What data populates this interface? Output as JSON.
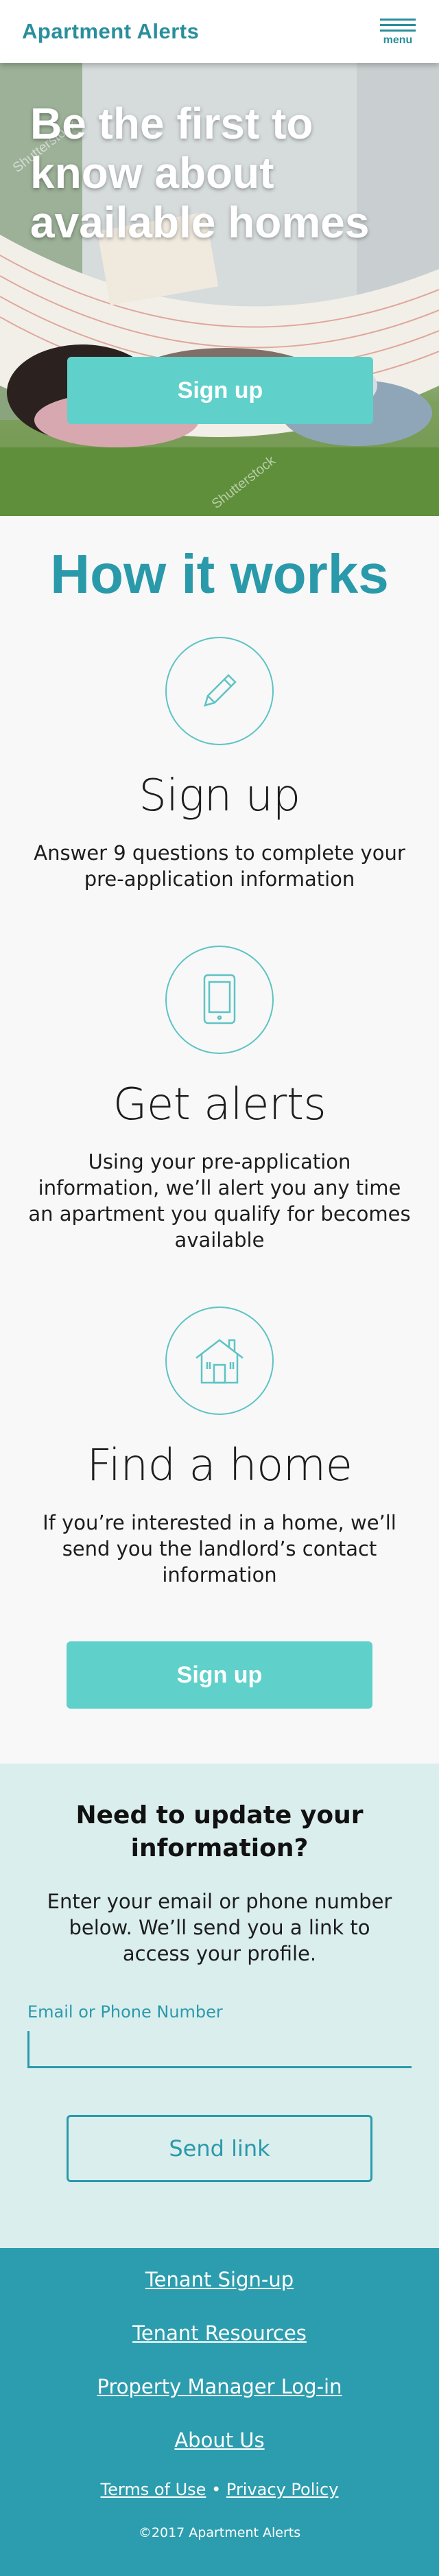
{
  "header": {
    "logo_text": "Apartment Alerts",
    "menu_label": "menu"
  },
  "hero": {
    "title": "Be the first to know about available homes",
    "signup_label": "Sign up",
    "watermark_text": "Shutterstock"
  },
  "how_it_works": {
    "title": "How it works",
    "steps": [
      {
        "title": "Sign up",
        "description": "Answer 9 questions to complete your pre-application information",
        "icon": "pencil-icon"
      },
      {
        "title": "Get alerts",
        "description": "Using your pre-application information, we’ll alert you any time an apartment you qualify for becomes available",
        "icon": "tablet-icon"
      },
      {
        "title": "Find a home",
        "description": "If you’re interested in a home, we’ll send you the landlord’s contact information",
        "icon": "house-icon"
      }
    ],
    "signup_label": "Sign up"
  },
  "update": {
    "title": "Need to update your information?",
    "description": "Enter your email or phone number below. We’ll send you a link to access your profile.",
    "field_label": "Email or Phone Number",
    "field_value": "",
    "send_label": "Send link"
  },
  "footer": {
    "links": [
      "Tenant Sign-up",
      "Tenant Resources",
      "Property Manager Log-in",
      "About Us"
    ],
    "terms_label": "Terms of Use",
    "separator": "•",
    "privacy_label": "Privacy Policy",
    "copyright": "©2017 Apartment Alerts"
  },
  "colors": {
    "brand": "#2a8e9c",
    "accent_button": "#5fd0ca",
    "update_bg": "#dbeeee",
    "footer_bg": "#2c9dae"
  }
}
